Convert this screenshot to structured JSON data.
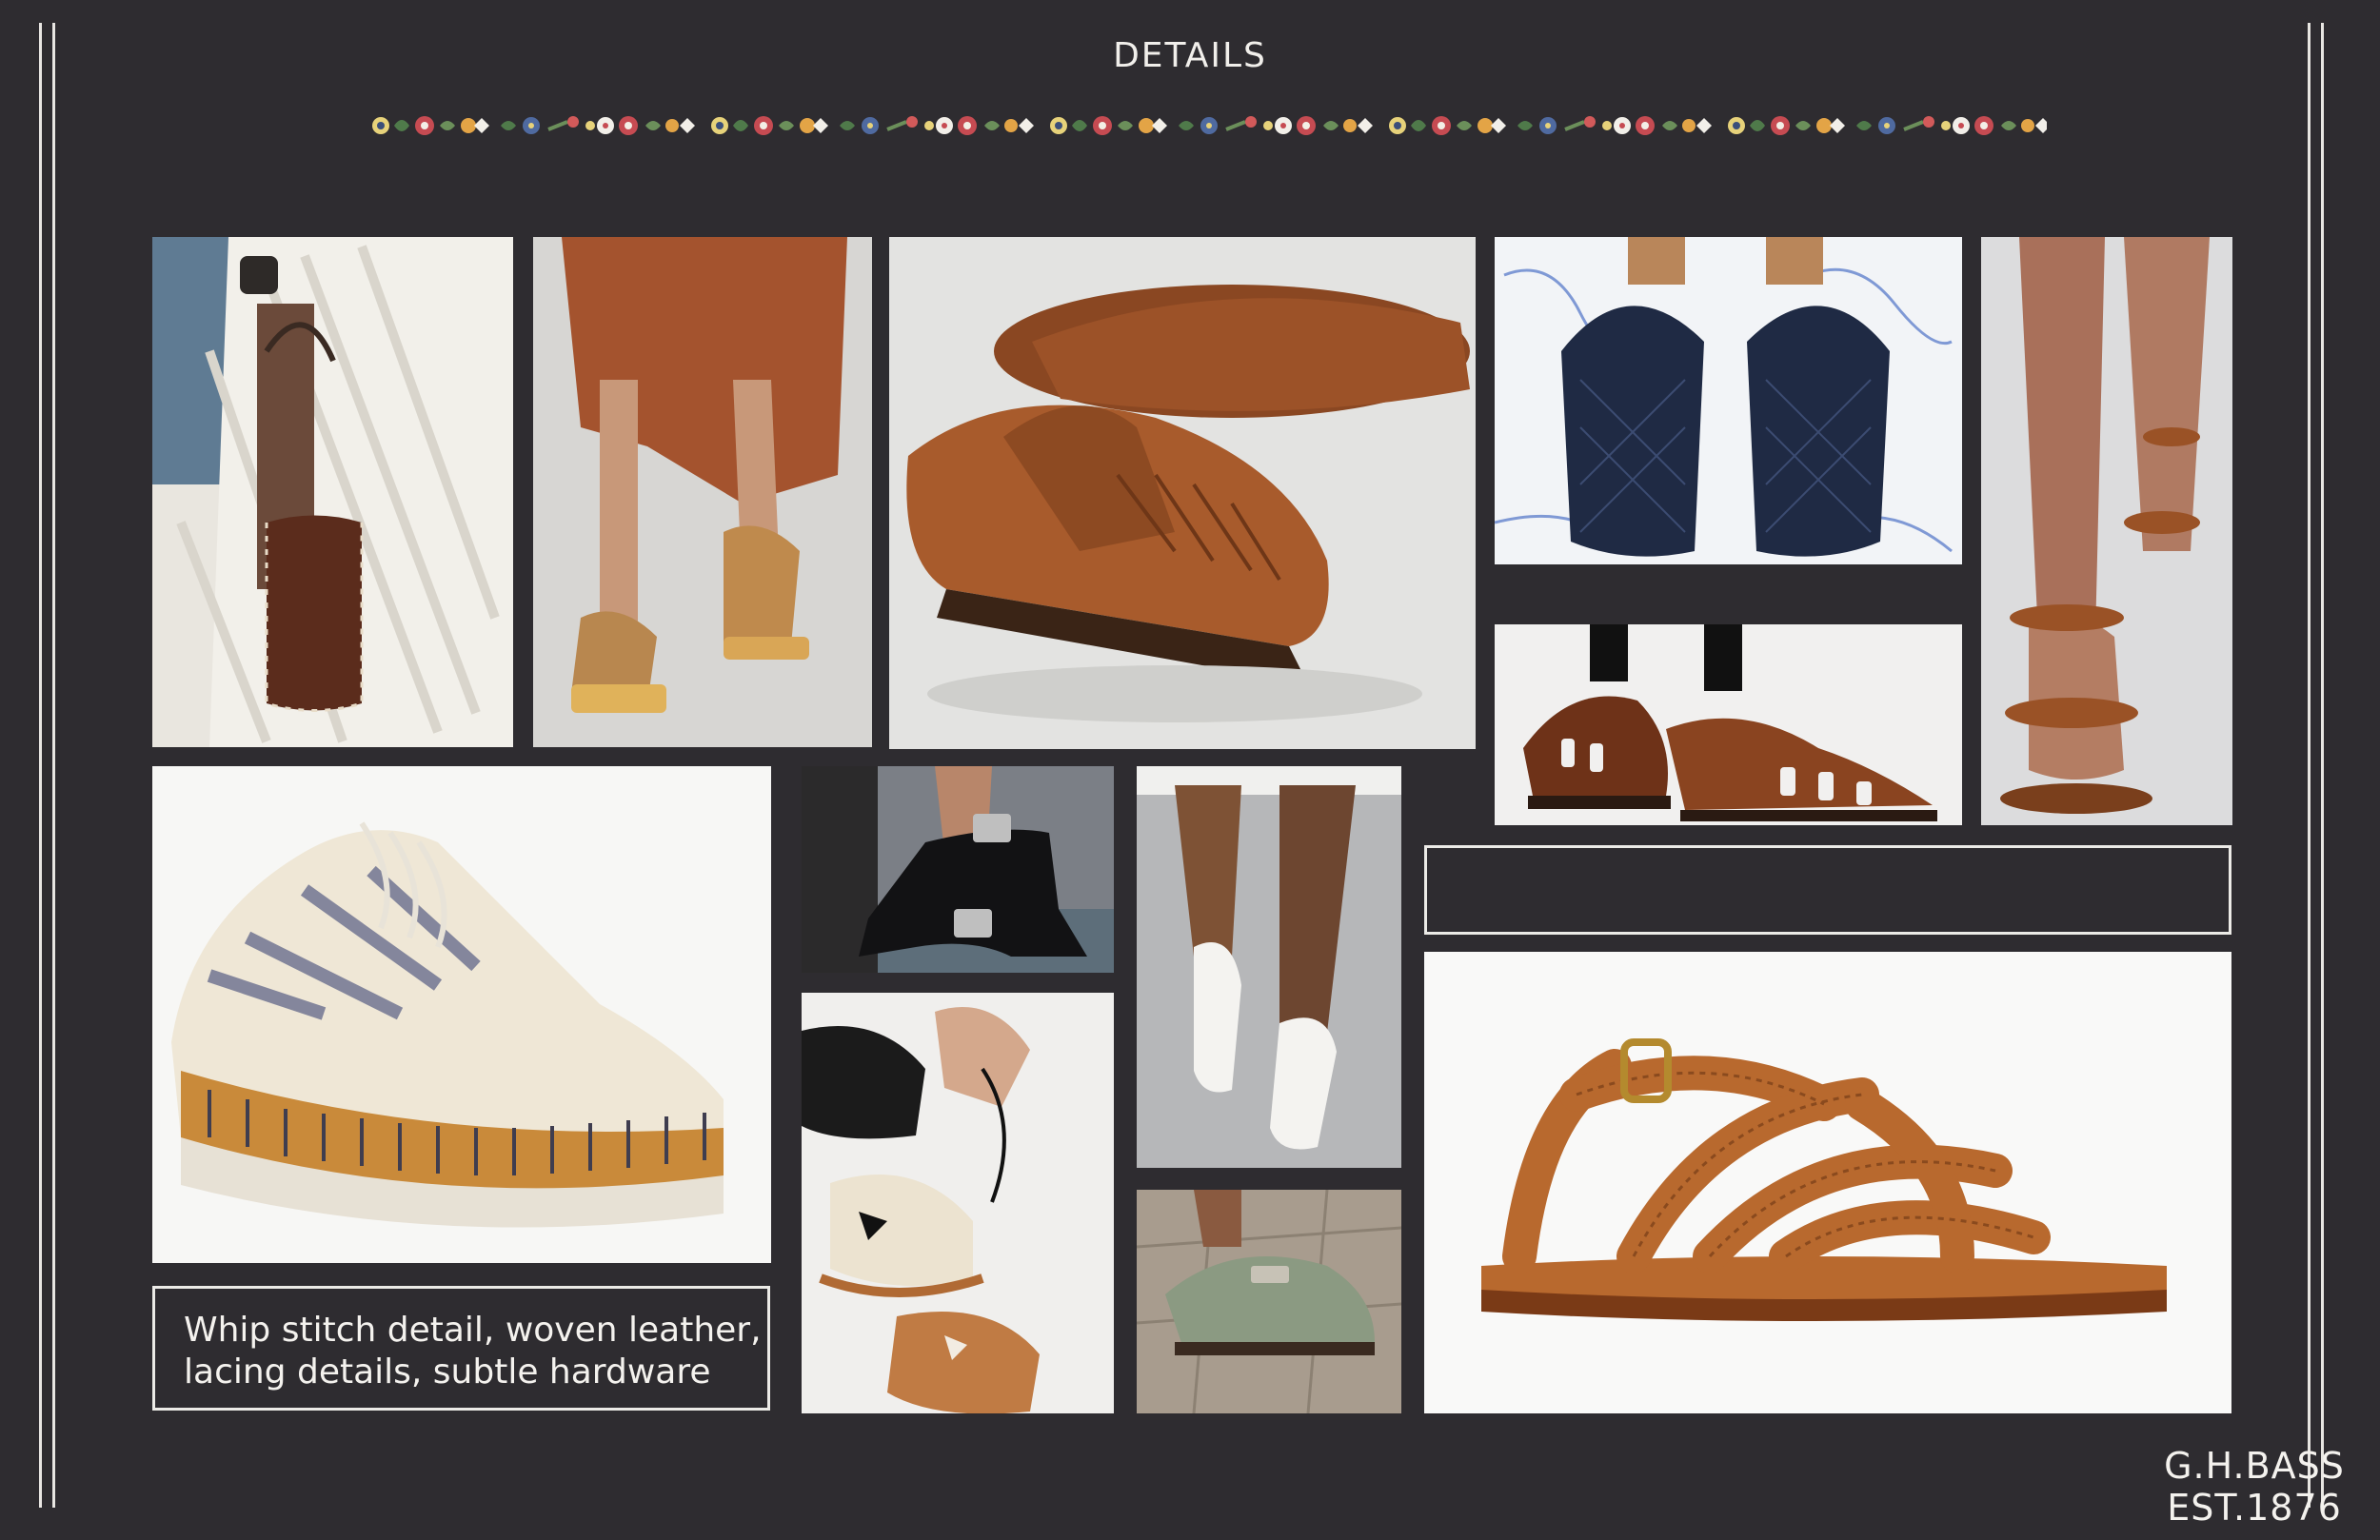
{
  "header": {
    "title": "DETAILS"
  },
  "decoration": {
    "name": "folk-floral-border"
  },
  "photos": [
    {
      "name": "photo-woven-bucket-bag",
      "subject": "runway model holding brown leather bucket bag with whip stitching"
    },
    {
      "name": "photo-lace-up-espadrille",
      "subject": "runway model in woven lace-up sandals"
    },
    {
      "name": "photo-woven-penny-loafer",
      "subject": "brown woven leather penny loafers"
    },
    {
      "name": "photo-navy-woven-loafer",
      "subject": "navy woven leather loafers with shoe trees"
    },
    {
      "name": "photo-braided-strap-sandal",
      "subject": "runway model in braided tan strap sandals"
    },
    {
      "name": "photo-fisherman-sandal",
      "subject": "brown leather fisherman sandals"
    },
    {
      "name": "photo-crochet-sneaker",
      "subject": "crochet knit platform sneaker"
    },
    {
      "name": "photo-buckle-sandal",
      "subject": "black leather buckle heeled sandal"
    },
    {
      "name": "photo-ballet-flat",
      "subject": "white leather ballet flats with bow"
    },
    {
      "name": "photo-lacing-espadrilles",
      "subject": "hands tying espadrille ribbons"
    },
    {
      "name": "photo-suede-clog",
      "subject": "green suede clog mule"
    },
    {
      "name": "photo-crisscross-sandal",
      "subject": "tan leather crisscross strap sandal with brass buckle"
    }
  ],
  "caption": {
    "line1": "Whip stitch detail, woven leather,",
    "line2": "lacing details, subtle hardware"
  },
  "brand": {
    "name": "G.H.BASS",
    "est": "EST.1876"
  },
  "colors": {
    "background": "#2e2c30",
    "text": "#f1efeb",
    "leather": "#a8622e"
  }
}
